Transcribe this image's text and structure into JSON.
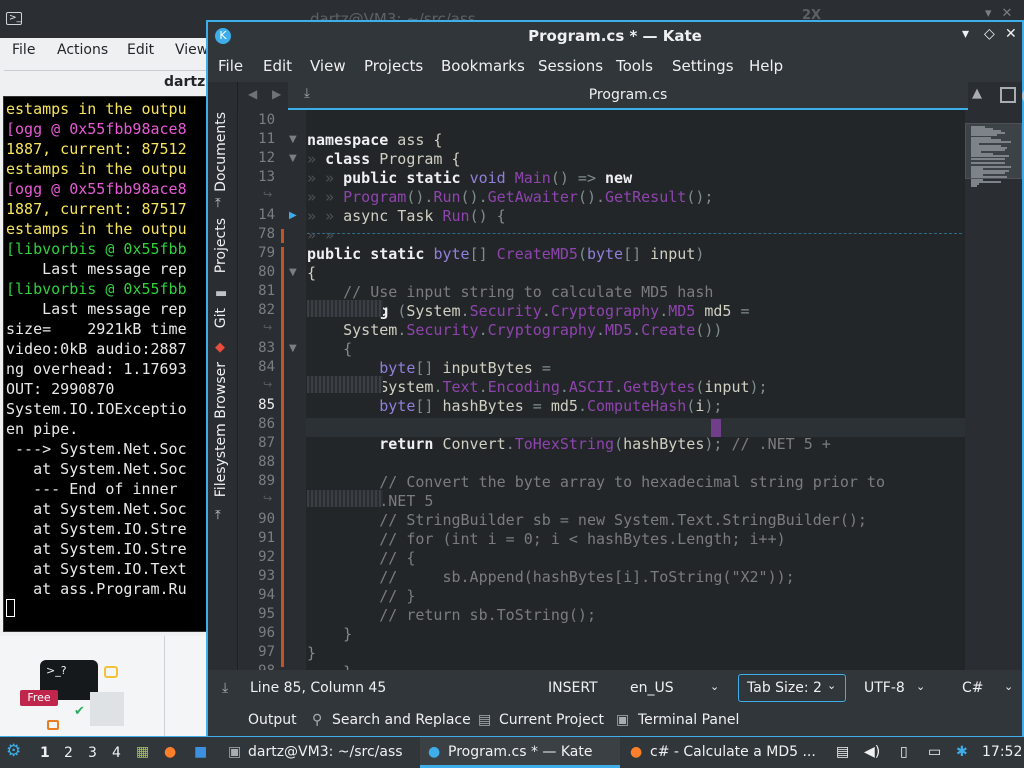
{
  "background": {
    "title": "dartz@VM3: ~/src/ass",
    "min_glyph": "2X"
  },
  "konsole": {
    "menu": [
      "File",
      "Actions",
      "Edit",
      "View"
    ],
    "tab_title": "dartz",
    "lines": [
      {
        "text": "estamps in the outpu",
        "color": "y"
      },
      {
        "text": "[ogg @ 0x55fbb98ace8",
        "color": "m"
      },
      {
        "text": "1887, current: 87512",
        "color": "y"
      },
      {
        "text": "estamps in the outpu",
        "color": "y"
      },
      {
        "text": "[ogg @ 0x55fbb98ace8",
        "color": "m"
      },
      {
        "text": "1887, current: 87517",
        "color": "y"
      },
      {
        "text": "estamps in the outpu",
        "color": "y"
      },
      {
        "text": "[libvorbis @ 0x55fbb",
        "color": "g"
      },
      {
        "text": "    Last message rep",
        "color": "w"
      },
      {
        "text": "[libvorbis @ 0x55fbb",
        "color": "g"
      },
      {
        "text": "    Last message rep",
        "color": "w"
      },
      {
        "text": "size=    2921kB time",
        "color": "w"
      },
      {
        "text": "video:0kB audio:2887",
        "color": "w"
      },
      {
        "text": "ng overhead: 1.17693",
        "color": "w"
      },
      {
        "text": "OUT: 2990870",
        "color": "w"
      },
      {
        "text": "System.IO.IOExceptio",
        "color": "w"
      },
      {
        "text": "en pipe.",
        "color": "w"
      },
      {
        "text": " ---> System.Net.Soc",
        "color": "w"
      },
      {
        "text": "   at System.Net.Soc",
        "color": "w"
      },
      {
        "text": "   --- End of inner",
        "color": "w"
      },
      {
        "text": "   at System.Net.Soc",
        "color": "w"
      },
      {
        "text": "   at System.IO.Stre",
        "color": "w"
      },
      {
        "text": "   at System.IO.Stre",
        "color": "w"
      },
      {
        "text": "   at System.IO.Text",
        "color": "w"
      },
      {
        "text": "   at ass.Program.Ru",
        "color": "w"
      }
    ]
  },
  "widget": {
    "card_text": ">_?",
    "badge": "Free"
  },
  "kate": {
    "title": "Program.cs * — Kate",
    "menu": [
      "File",
      "Edit",
      "View",
      "Projects",
      "Bookmarks",
      "Sessions",
      "Tools",
      "Settings",
      "Help"
    ],
    "tab": "Program.cs",
    "sidebar": [
      "Documents",
      "Projects",
      "Git",
      "Filesystem Browser"
    ],
    "status": {
      "position": "Line 85, Column 45",
      "mode": "INSERT",
      "language": "en_US",
      "tab_size": "Tab Size: 2",
      "encoding": "UTF-8",
      "syntax": "C#"
    },
    "toolviews": [
      "Output",
      "Search and Replace",
      "Current Project",
      "Terminal Panel"
    ]
  },
  "taskbar": {
    "desktops": [
      "1",
      "2",
      "3",
      "4"
    ],
    "tasks": [
      "dartz@VM3: ~/src/ass",
      "Program.cs * — Kate",
      "c# - Calculate a MD5 ..."
    ],
    "clock": "17:52"
  },
  "code": {
    "line_numbers": [
      "10",
      "11",
      "12",
      "13",
      "",
      "14",
      "78",
      "79",
      "80",
      "81",
      "82",
      "",
      "83",
      "84",
      "",
      "85",
      "86",
      "87",
      "88",
      "89",
      "",
      "90",
      "91",
      "92",
      "93",
      "94",
      "95",
      "96",
      "97",
      "98"
    ]
  }
}
